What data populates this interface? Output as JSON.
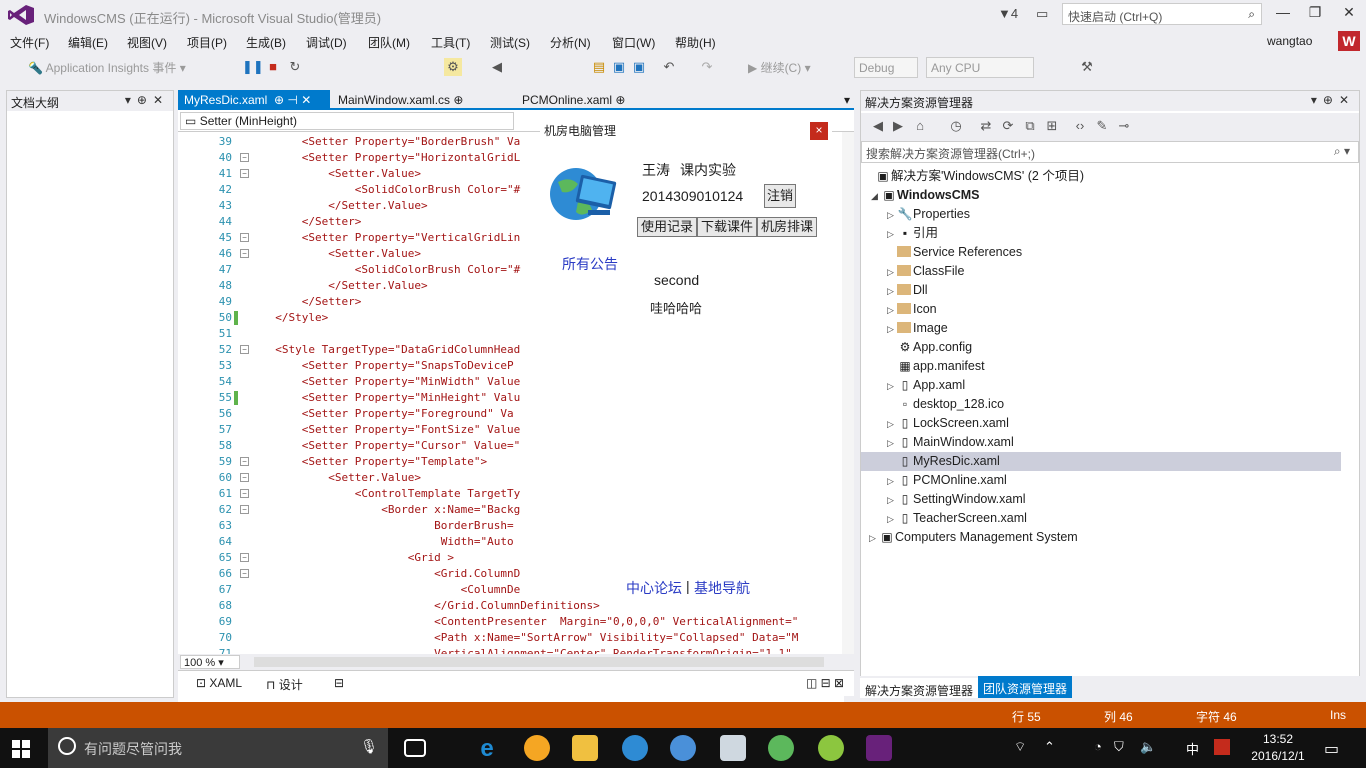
{
  "window": {
    "title": "WindowsCMS (正在运行) - Microsoft Visual Studio(管理员)",
    "notif_count": "4",
    "quick_launch_placeholder": "快速启动 (Ctrl+Q)",
    "user": "wangtao",
    "avatar": "W"
  },
  "menu": [
    "文件(F)",
    "编辑(E)",
    "视图(V)",
    "项目(P)",
    "生成(B)",
    "调试(D)",
    "团队(M)",
    "工具(T)",
    "测试(S)",
    "分析(N)",
    "窗口(W)",
    "帮助(H)"
  ],
  "toolbar": {
    "insights": "Application Insights 事件",
    "continue": "继续(C)",
    "config": "Debug",
    "platform": "Any CPU"
  },
  "left_panel": {
    "title": "文档大纲"
  },
  "editor": {
    "tabs": [
      "MyResDic.xaml",
      "MainWindow.xaml.cs",
      "PCMOnline.xaml"
    ],
    "nav_combo": "Setter (MinHeight)",
    "zoom": "100 %",
    "view_tabs": [
      "XAML",
      "设计"
    ],
    "lines": [
      {
        "n": "39",
        "t": "      <Setter Property=\"BorderBrush\" Va"
      },
      {
        "n": "40",
        "t": "      <Setter Property=\"HorizontalGridL"
      },
      {
        "n": "41",
        "t": "          <Setter.Value>"
      },
      {
        "n": "42",
        "t": "              <SolidColorBrush Color=\"#"
      },
      {
        "n": "43",
        "t": "          </Setter.Value>"
      },
      {
        "n": "44",
        "t": "      </Setter>"
      },
      {
        "n": "45",
        "t": "      <Setter Property=\"VerticalGridLin"
      },
      {
        "n": "46",
        "t": "          <Setter.Value>"
      },
      {
        "n": "47",
        "t": "              <SolidColorBrush Color=\"#"
      },
      {
        "n": "48",
        "t": "          </Setter.Value>"
      },
      {
        "n": "49",
        "t": "      </Setter>"
      },
      {
        "n": "50",
        "t": "  </Style>"
      },
      {
        "n": "51",
        "t": ""
      },
      {
        "n": "52",
        "t": "  <Style TargetType=\"DataGridColumnHead"
      },
      {
        "n": "53",
        "t": "      <Setter Property=\"SnapsToDeviceP"
      },
      {
        "n": "54",
        "t": "      <Setter Property=\"MinWidth\" Value"
      },
      {
        "n": "55",
        "t": "      <Setter Property=\"MinHeight\" Valu"
      },
      {
        "n": "56",
        "t": "      <Setter Property=\"Foreground\" Va"
      },
      {
        "n": "57",
        "t": "      <Setter Property=\"FontSize\" Value"
      },
      {
        "n": "58",
        "t": "      <Setter Property=\"Cursor\" Value=\""
      },
      {
        "n": "59",
        "t": "      <Setter Property=\"Template\">"
      },
      {
        "n": "60",
        "t": "          <Setter.Value>"
      },
      {
        "n": "61",
        "t": "              <ControlTemplate TargetTy"
      },
      {
        "n": "62",
        "t": "                  <Border x:Name=\"Backg"
      },
      {
        "n": "63",
        "t": "                          BorderBrush="
      },
      {
        "n": "64",
        "t": "                           Width=\"Auto"
      },
      {
        "n": "65",
        "t": "                      <Grid >"
      },
      {
        "n": "66",
        "t": "                          <Grid.ColumnD"
      },
      {
        "n": "67",
        "t": "                              <ColumnDe"
      },
      {
        "n": "68",
        "t": "                          </Grid.ColumnDefinitions>"
      },
      {
        "n": "69",
        "t": "                          <ContentPresenter  Margin=\"0,0,0,0\" VerticalAlignment=\""
      },
      {
        "n": "70",
        "t": "                          <Path x:Name=\"SortArrow\" Visibility=\"Collapsed\" Data=\"M"
      },
      {
        "n": "71",
        "t": "                          VerticalAlignment=\"Center\" RenderTransformOrigin=\"1,1\""
      }
    ]
  },
  "dialog": {
    "title": "机房电脑管理",
    "close": "×",
    "name": "王涛",
    "course": "课内实验",
    "student_id": "2014309010124",
    "logout": "注销",
    "buttons": [
      "使用记录",
      "下载课件",
      "机房排课"
    ],
    "announcements": "所有公告",
    "notice_title": "second",
    "notice_body": "哇哈哈哈",
    "footer_link1": "中心论坛",
    "footer_sep": "|",
    "footer_link2": "基地导航"
  },
  "solution": {
    "title": "解决方案资源管理器",
    "search_placeholder": "搜索解决方案资源管理器(Ctrl+;)",
    "root": "解决方案'WindowsCMS' (2 个项目)",
    "project": "WindowsCMS",
    "items": [
      "Properties",
      "引用",
      "Service References",
      "ClassFile",
      "Dll",
      "Icon",
      "Image",
      "App.config",
      "app.manifest",
      "App.xaml",
      "desktop_128.ico",
      "LockScreen.xaml",
      "MainWindow.xaml",
      "MyResDic.xaml",
      "PCMOnline.xaml",
      "SettingWindow.xaml",
      "TeacherScreen.xaml"
    ],
    "project2": "Computers Management System",
    "tabs": [
      "解决方案资源管理器",
      "团队资源管理器"
    ]
  },
  "status": {
    "row": "行 55",
    "col": "列 46",
    "char": "字符 46",
    "mode": "Ins"
  },
  "taskbar": {
    "search": "有问题尽管问我",
    "time": "13:52",
    "date": "2016/12/1",
    "ime": "中"
  }
}
